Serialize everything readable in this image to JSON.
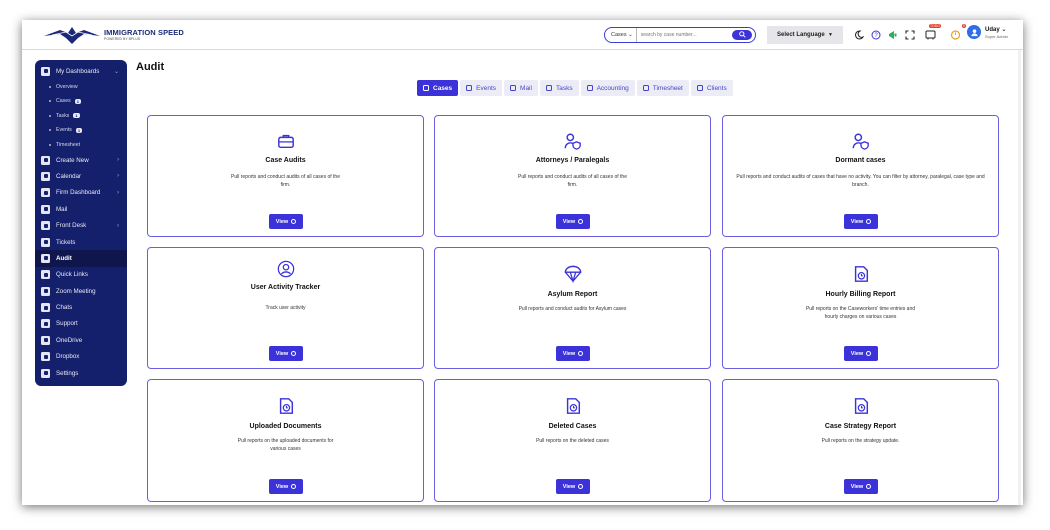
{
  "brand": {
    "title": "IMMIGRATION SPEED",
    "subtitle": "POWERED BY BPLUS"
  },
  "search": {
    "type": "Cases",
    "placeholder": "search by case number..."
  },
  "language": {
    "label": "Select Language",
    "arrow": "▼"
  },
  "header_icons": [
    {
      "name": "moon-icon"
    },
    {
      "name": "help-icon"
    },
    {
      "name": "megaphone-icon"
    },
    {
      "name": "fullscreen-icon"
    },
    {
      "name": "todo-icon",
      "badge": "TODO"
    },
    {
      "name": "timer-icon",
      "badge": "0"
    }
  ],
  "user": {
    "name": "Uday",
    "role": "Super Admin"
  },
  "sidebar": {
    "top": {
      "label": "My Dashboards"
    },
    "subs": [
      {
        "label": "Overview",
        "count": ""
      },
      {
        "label": "Cases",
        "count": "1"
      },
      {
        "label": "Tasks",
        "count": "1"
      },
      {
        "label": "Events",
        "count": "1"
      },
      {
        "label": "Timesheet",
        "count": ""
      }
    ],
    "items": [
      {
        "label": "Create New",
        "chev": "›"
      },
      {
        "label": "Calendar",
        "chev": "›"
      },
      {
        "label": "Firm Dashboard",
        "chev": "›"
      },
      {
        "label": "Mail",
        "chev": ""
      },
      {
        "label": "Front Desk",
        "chev": "›"
      },
      {
        "label": "Tickets",
        "chev": ""
      },
      {
        "label": "Audit",
        "chev": ""
      },
      {
        "label": "Quick Links",
        "chev": ""
      },
      {
        "label": "Zoom Meeting",
        "chev": ""
      },
      {
        "label": "Chats",
        "chev": ""
      },
      {
        "label": "Support",
        "chev": ""
      },
      {
        "label": "OneDrive",
        "chev": ""
      },
      {
        "label": "Dropbox",
        "chev": ""
      },
      {
        "label": "Settings",
        "chev": ""
      }
    ],
    "active": "Audit"
  },
  "page": {
    "title": "Audit"
  },
  "tabs": [
    {
      "label": "Cases",
      "active": true
    },
    {
      "label": "Events",
      "active": false
    },
    {
      "label": "Mail",
      "active": false
    },
    {
      "label": "Tasks",
      "active": false
    },
    {
      "label": "Accounting",
      "active": false
    },
    {
      "label": "Timesheet",
      "active": false
    },
    {
      "label": "Clients",
      "active": false
    }
  ],
  "view_label": "View",
  "cards": [
    {
      "title": "Case Audits",
      "desc": "Pull reports and conduct audits of all cases of the firm.",
      "icon": "briefcase-icon"
    },
    {
      "title": "Attorneys / Paralegals",
      "desc": "Pull reports and conduct audits of all cases of the firm.",
      "icon": "user-shield-icon"
    },
    {
      "title": "Dormant cases",
      "desc": "Pull reports and conduct audits of cases that have no activity. You can filter by attorney, paralegal, case type and branch.",
      "icon": "user-shield-icon"
    },
    {
      "title": "User Activity Tracker",
      "desc": "Track user activity",
      "icon": "user-circle-icon"
    },
    {
      "title": "Asylum Report",
      "desc": "Pull reports and conduct audits for Asylum cases",
      "icon": "parachute-icon"
    },
    {
      "title": "Hourly Billing Report",
      "desc": "Pull reports on the Caseworkers' time entries and hourly charges on various cases",
      "icon": "report-clock-icon"
    },
    {
      "title": "Uploaded Documents",
      "desc": "Pull reports on the uploaded documents for various cases",
      "icon": "report-clock-icon"
    },
    {
      "title": "Deleted Cases",
      "desc": "Pull reports on the deleted cases",
      "icon": "report-clock-icon"
    },
    {
      "title": "Case Strategy Report",
      "desc": "Pull reports on the strategy update.",
      "icon": "report-clock-icon"
    }
  ],
  "colors": {
    "accent": "#3b32d9",
    "sidebar": "#14206b",
    "card_border": "#6a5fe0"
  }
}
